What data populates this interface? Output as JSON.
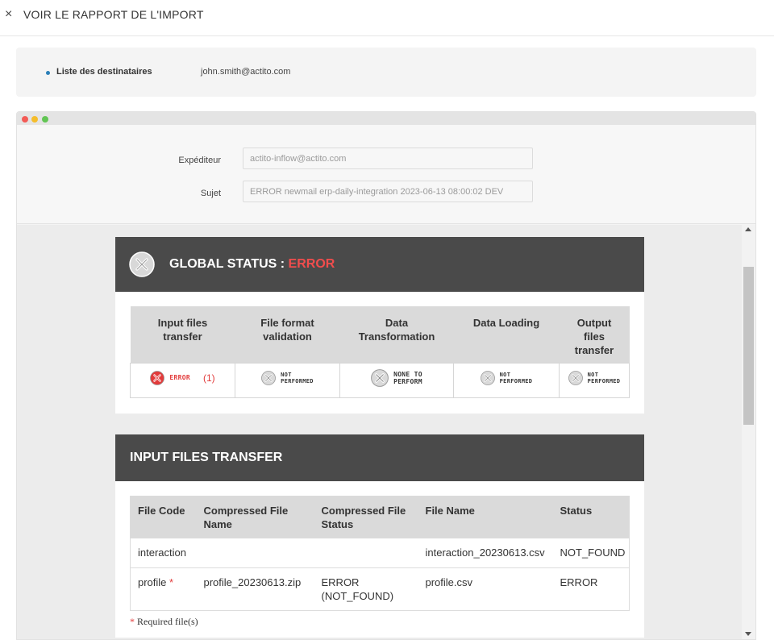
{
  "header": {
    "close_glyph": "×",
    "title": "VOIR LE RAPPORT DE L'IMPORT"
  },
  "recipients": {
    "label": "Liste des destinataires",
    "value": "john.smith@actito.com"
  },
  "meta": {
    "sender_label": "Expéditeur",
    "sender_value": "actito-inflow@actito.com",
    "subject_label": "Sujet",
    "subject_value": "ERROR newmail erp-daily-integration 2023-06-13 08:00:02 DEV"
  },
  "global_status": {
    "title": "GLOBAL STATUS : ",
    "status": "ERROR",
    "steps": [
      {
        "header_line1": "Input files",
        "header_line2": "transfer",
        "header_line3": "",
        "status_line1": "ERROR",
        "status_line2": "",
        "count": "(1)"
      },
      {
        "header_line1": "File format",
        "header_line2": "validation",
        "header_line3": "",
        "status_line1": "NOT",
        "status_line2": "PERFORMED",
        "count": ""
      },
      {
        "header_line1": "Data",
        "header_line2": "Transformation",
        "header_line3": "",
        "status_line1": "NONE TO",
        "status_line2": "PERFORM",
        "count": ""
      },
      {
        "header_line1": "Data Loading",
        "header_line2": "",
        "header_line3": "",
        "status_line1": "NOT",
        "status_line2": "PERFORMED",
        "count": ""
      },
      {
        "header_line1": "Output",
        "header_line2": "files",
        "header_line3": "transfer",
        "status_line1": "NOT",
        "status_line2": "PERFORMED",
        "count": ""
      }
    ]
  },
  "input_files": {
    "title": "INPUT FILES TRANSFER",
    "columns": {
      "file_code": "File Code",
      "compressed_name": "Compressed File Name",
      "compressed_status": "Compressed File Status",
      "file_name": "File Name",
      "status": "Status"
    },
    "rows": [
      {
        "file_code": "interaction",
        "required_mark": "",
        "compressed_name": "",
        "compressed_status_1": "",
        "compressed_status_2": "",
        "file_name": "interaction_20230613.csv",
        "status": "NOT_FOUND"
      },
      {
        "file_code": "profile",
        "required_mark": "*",
        "compressed_name": "profile_20230613.zip",
        "compressed_status_1": "ERROR",
        "compressed_status_2": "(NOT_FOUND)",
        "file_name": "profile.csv",
        "status": "ERROR"
      }
    ],
    "required_note_mark": "*",
    "required_note": " Required file(s)"
  },
  "colors": {
    "error": "#e23b3b",
    "header_bg": "#4a4a4a",
    "accent_dot": "#2a7fb8"
  },
  "icons": [
    "close-icon",
    "error-x-icon",
    "status-x-icon",
    "scroll-up-icon",
    "scroll-down-icon"
  ]
}
